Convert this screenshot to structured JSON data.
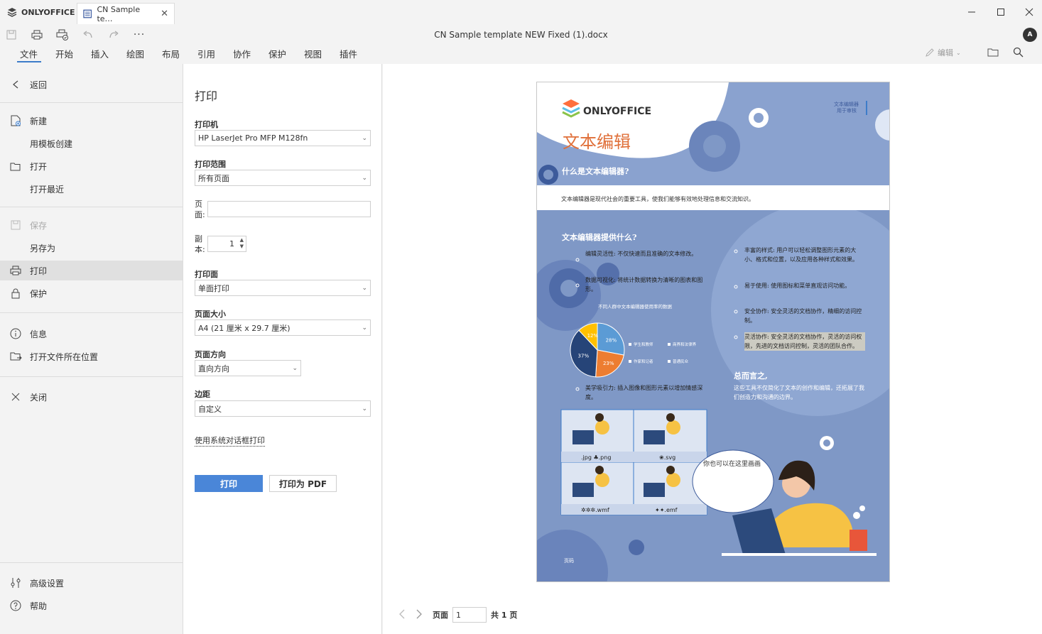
{
  "app": {
    "brand": "ONLYOFFICE",
    "tab_label": "CN Sample te…",
    "doc_title": "CN Sample template NEW Fixed (1).docx",
    "avatar": "A"
  },
  "menus": [
    "文件",
    "开始",
    "插入",
    "绘图",
    "布局",
    "引用",
    "协作",
    "保护",
    "视图",
    "插件"
  ],
  "toolbar": {
    "edit_label": "编辑"
  },
  "left_menu": {
    "back": "返回",
    "new": "新建",
    "from_template": "用模板创建",
    "open": "打开",
    "open_recent": "打开最近",
    "save": "保存",
    "save_as": "另存为",
    "print": "打印",
    "protect": "保护",
    "info": "信息",
    "open_location": "打开文件所在位置",
    "close": "关闭",
    "advanced": "高级设置",
    "help": "帮助"
  },
  "print": {
    "title": "打印",
    "printer_label": "打印机",
    "printer_value": "HP LaserJet Pro MFP M128fn",
    "range_label": "打印范围",
    "range_value": "所有页面",
    "pages_label": "页面:",
    "copies_label": "副本:",
    "copies_value": "1",
    "sides_label": "打印面",
    "sides_value": "单面打印",
    "size_label": "页面大小",
    "size_value": "A4 (21 厘米 x 29.7 厘米)",
    "orientation_label": "页面方向",
    "orientation_value": "直向方向",
    "margins_label": "边距",
    "margins_value": "自定义",
    "system_dialog": "使用系统对话框打印",
    "print_button": "打印",
    "pdf_button": "打印为 PDF"
  },
  "pager": {
    "page_label": "页面",
    "page_value": "1",
    "total": "共 1 页"
  },
  "doc": {
    "logo_text": "ONLYOFFICE",
    "heading": "文本编辑",
    "side_note_1": "文本编辑器",
    "side_note_2": "用于审核",
    "q1": "什么是文本编辑器?",
    "intro": "文本编辑器是现代社会的重要工具，使我们能够有效地处理信息和交流知识。",
    "q2": "文本编辑器提供什么?",
    "b1": "编辑灵活性: 不仅快速而且准确的文本修改。",
    "b2": "数据可视化: 将统计数据转换为清晰的图表和图形。",
    "chart_caption": "不同人群中文本编辑器使用率的数据",
    "b3": "美学吸引力: 插入图像和图形元素以增加情感深度。",
    "r1": "丰富的样式: 用户可以轻松调整图形元素的大小、格式和位置，以及应用各种样式和效果。",
    "r2": "易于使用: 使用图标和菜单直观访问功能。",
    "r3": "安全协作: 安全灵活的文档协作，精细的访问控制。",
    "r4": "灵活协作: 安全灵活的文档协作，灵活的访问权限，先进的文档访问控制，灵活的团队合作。",
    "summary_title": "总而言之,",
    "summary_text": "这些工具不仅简化了文本的创作和编辑，还拓展了我们创造力和沟通的边界。",
    "bubble": "你也可以在这里画画",
    "footer": "页码",
    "img1": ".jpg ♣.png",
    "img2": "❀.svg",
    "img3": "✲✲✲.wmf",
    "img4": "✦✦.emf",
    "legend": [
      "学生和教师",
      "商界和法律界",
      "作家和记者",
      "普通民众"
    ]
  },
  "chart_data": {
    "type": "pie",
    "title": "不同人群中文本编辑器使用率的数据",
    "categories": [
      "学生和教师",
      "商界和法律界",
      "作家和记者",
      "普通民众"
    ],
    "values": [
      28,
      23,
      37,
      12
    ],
    "colors": [
      "#5b9bd5",
      "#ed7d31",
      "#264478",
      "#ffc000"
    ]
  }
}
